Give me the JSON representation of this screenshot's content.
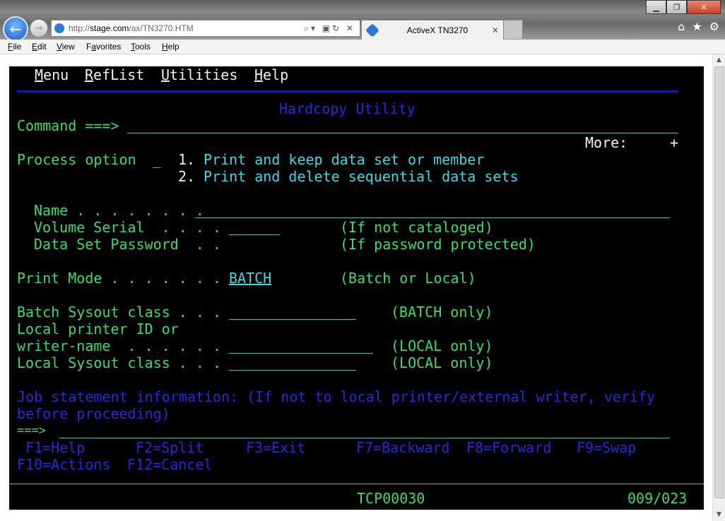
{
  "browser": {
    "url_domain": "stage.com",
    "url_prefix": "http://",
    "url_path": "/ax/TN3270.HTM",
    "addr_tools": "⌕▾ ▣↻ ✕",
    "tab_title": "ActiveX TN3270",
    "tab_close": "✕",
    "menu": [
      {
        "key": "F",
        "rest": "ile"
      },
      {
        "key": "E",
        "rest": "dit"
      },
      {
        "key": "V",
        "rest": "iew"
      },
      {
        "key": "a",
        "pre": "F",
        "rest": "vorites"
      },
      {
        "key": "T",
        "rest": "ools"
      },
      {
        "key": "H",
        "rest": "elp"
      }
    ],
    "icons": [
      "back-arrow-icon",
      "forward-arrow-icon",
      "home-icon",
      "star-icon",
      "gear-icon"
    ]
  },
  "terminal": {
    "action_bar": [
      {
        "key": "M",
        "rest": "enu"
      },
      {
        "key": "R",
        "rest": "efList"
      },
      {
        "key": "U",
        "rest": "tilities"
      },
      {
        "key": "H",
        "rest": "elp"
      }
    ],
    "panel_title": "Hardcopy Utility",
    "command_label": "Command ===>",
    "command_value": "",
    "more_label": "More:",
    "more_sign": "+",
    "process_option_label": "Process option",
    "process_option_value": "_",
    "options": [
      {
        "num": "1.",
        "text": "Print and keep data set or member"
      },
      {
        "num": "2.",
        "text": "Print and delete sequential data sets"
      }
    ],
    "name_label": "Name . . . . . . . .",
    "volume_label": "Volume Serial  . . . .",
    "volume_hint": "(If not cataloged)",
    "password_label": "Data Set Password  . .",
    "password_hint": "(If password protected)",
    "print_mode_label": "Print Mode . . . . . . .",
    "print_mode_value": "BATCH",
    "print_mode_hint": "(Batch or Local)",
    "batch_sysout_label": "Batch Sysout class . . .",
    "batch_sysout_hint": "(BATCH only)",
    "local_printer_label": "Local printer ID or",
    "writer_name_label": "writer-name  . . . . . .",
    "writer_name_hint": "(LOCAL only)",
    "local_sysout_label": "Local Sysout class . . .",
    "local_sysout_hint": "(LOCAL only)",
    "job_info_line1": "Job statement information: (If not to local printer/external writer, verify",
    "job_info_line2": "before proceeding)",
    "job_prompt": "===>",
    "fkeys_row1": [
      " F1=Help",
      "F2=Split",
      "F3=Exit",
      "F7=Backward",
      "F8=Forward",
      "F9=Swap"
    ],
    "fkeys_row2": [
      "F10=Actions",
      "F12=Cancel"
    ],
    "status_id": "TCP00030",
    "cursor_pos": "009/023"
  }
}
